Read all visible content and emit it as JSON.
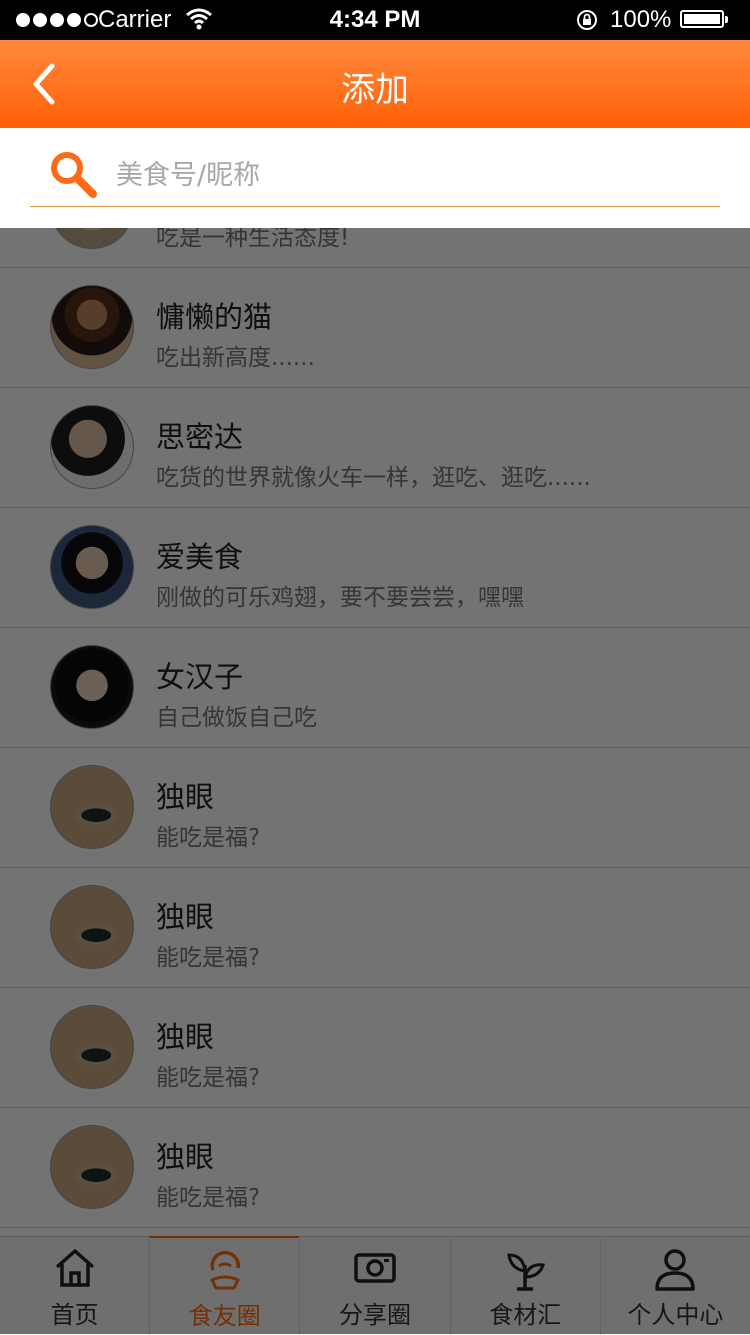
{
  "status_bar": {
    "carrier": "Carrier",
    "time": "4:34 PM",
    "battery": "100%"
  },
  "nav": {
    "title": "添加"
  },
  "search": {
    "placeholder": "美食号/昵称",
    "value": ""
  },
  "list": [
    {
      "name": "",
      "desc": "吃是一种生活态度!"
    },
    {
      "name": "慵懒的猫",
      "desc": "吃出新高度......"
    },
    {
      "name": "思密达",
      "desc": "吃货的世界就像火车一样，逛吃、逛吃......"
    },
    {
      "name": "爱美食",
      "desc": "刚做的可乐鸡翅，要不要尝尝，嘿嘿"
    },
    {
      "name": "女汉子",
      "desc": "自己做饭自己吃"
    },
    {
      "name": "独眼",
      "desc": "能吃是福?"
    },
    {
      "name": "独眼",
      "desc": "能吃是福?"
    },
    {
      "name": "独眼",
      "desc": "能吃是福?"
    },
    {
      "name": "独眼",
      "desc": "能吃是福?"
    }
  ],
  "tabs": [
    {
      "label": "首页",
      "icon": "home-icon"
    },
    {
      "label": "食友圈",
      "icon": "food-circle-icon"
    },
    {
      "label": "分享圈",
      "icon": "camera-icon"
    },
    {
      "label": "食材汇",
      "icon": "plant-icon"
    },
    {
      "label": "个人中心",
      "icon": "user-icon"
    }
  ],
  "colors": {
    "accent": "#ff6a14",
    "nav_top": "#ff8a3c",
    "nav_bottom": "#ff5f06"
  }
}
